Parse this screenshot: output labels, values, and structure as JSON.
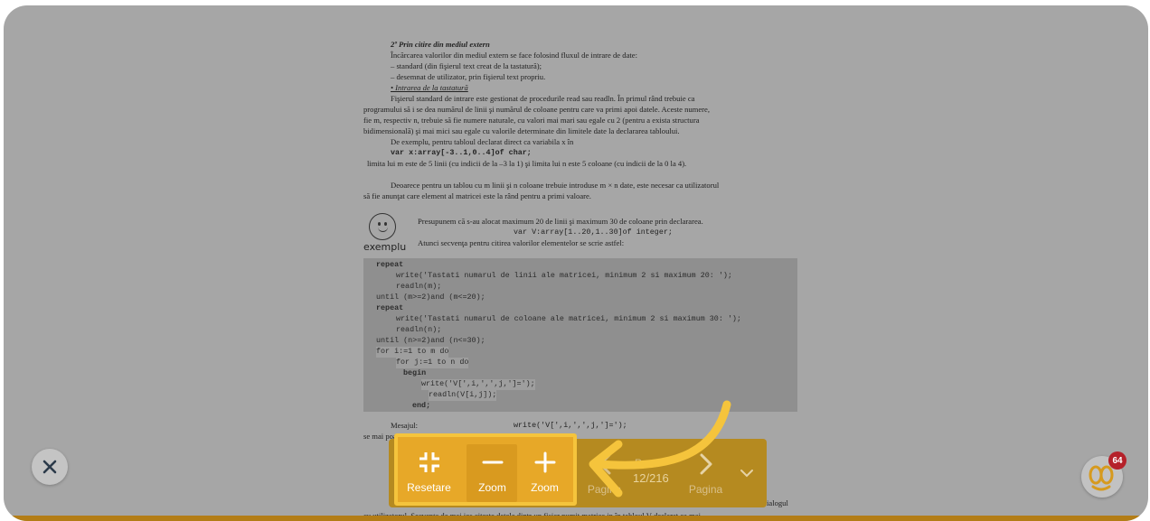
{
  "colors": {
    "overlay_gray": "#a6a6a6",
    "toolbar_bg": "#b58a20",
    "highlight_border": "#f5c43c",
    "highlight_fill": "#e7a828",
    "arrow": "#f5c43c",
    "badge": "#b5212a"
  },
  "document": {
    "heading": "2º Prin citire din mediul extern",
    "lines": [
      "Încărcarea valorilor din mediul extern se face folosind fluxul de intrare de date:",
      "– standard (din fişierul text creat de la tastatură);",
      "– desemnat de utilizator, prin fişierul text propriu.",
      "• Intrarea de la tastatură",
      "Fişierul standard de intrare este gestionat de procedurile read sau readln. În primul rând trebuie ca",
      "programului să i se dea numărul de linii şi numărul de coloane pentru care va primi apoi datele. Aceste numere,",
      "fie m, respectiv n, trebuie să fie numere naturale, cu valori mai mari sau egale cu 2 (pentru a exista structura",
      "bidimensională) şi mai mici sau egale cu valorile determinate din limitele date la declararea tabloului.",
      "De exemplu, pentru tabloul declarat direct ca variabila x în",
      "var x:array[-3..1,0..4]of char;",
      "limita lui m este de 5 linii (cu indicii de la –3 la 1) şi limita lui n este 5 coloane (cu indicii de la 0 la 4).",
      "Deoarece pentru un tablou cu m linii şi n coloane trebuie introduse m × n date, este necesar ca utilizatorul",
      "să fie anunţat care element al matricei este la rând pentru a primi valoare.",
      "Presupunem că s-au alocat maximum 20 de linii şi maximum 30 de coloane prin declararea.",
      "var V:array[1..20,1..30]of integer;",
      "Atunci secvenţa pentru citirea valorilor elementelor se scrie astfel:"
    ],
    "exemplu_label": "exemplu",
    "code": [
      "repeat",
      "write('Tastati numarul de linii ale matricei, minimum 2 si maximum 20: ');",
      "readln(m);",
      "until (m>=2)and (m<=20);",
      "repeat",
      "write('Tastati numarul de coloane ale matricei, minimum 2 si maximum 30: ');",
      "readln(n);",
      "until (n>=2)and (n<=30);",
      "for i:=1 to m do",
      "for j:=1 to n do",
      "begin",
      "write('V[',i,',',j,']=');",
      "readln(V[i,j]);",
      "end;"
    ],
    "mesajul_label": "Mesajul:",
    "mesajul_code": "write('V[',i,',',j,']=');",
    "after_line": "se mai poate formula şi astfel:",
    "bottom_line": "cu utilizatorul. Secvenţa de mai jos citeşte datele dintr-un fişier numit matrice.in în tabloul V declarat ca mai",
    "right_fragment": "ialogul"
  },
  "toolbar": {
    "reset_label": "Resetare",
    "zoom_out_label": "Zoom",
    "zoom_in_label": "Zoom",
    "prev_label": "Pagina",
    "page_counter": "12/216",
    "page_top_label": "Pa",
    "next_label": "Pagina"
  },
  "controls": {
    "close_icon": "close-icon",
    "badge_count": "64"
  }
}
